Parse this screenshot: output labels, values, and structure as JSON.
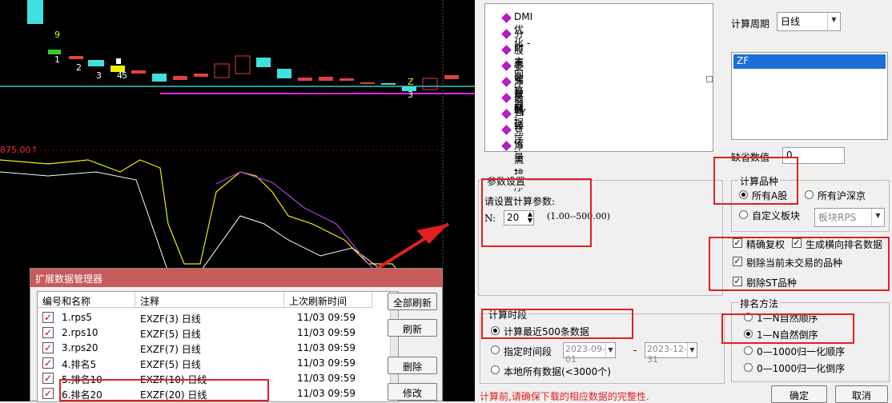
{
  "chart": {
    "numbers": [
      "9",
      "1",
      "2",
      "3",
      "4",
      "5",
      "Z",
      "3"
    ],
    "top_label": "875.00↑"
  },
  "manager": {
    "title": "扩展数据管理器",
    "headers": [
      "编号和名称",
      "注释",
      "上次刷新时间"
    ],
    "rows": [
      {
        "name": "1.rps5",
        "note": "EXZF(3) 日线",
        "time": "11/03 09:59"
      },
      {
        "name": "2.rps10",
        "note": "EXZF(5) 日线",
        "time": "11/03 09:59"
      },
      {
        "name": "3.rps20",
        "note": "EXZF(7) 日线",
        "time": "11/03 09:59"
      },
      {
        "name": "4.排名5",
        "note": "EXZF(5) 日线",
        "time": "11/03 09:59"
      },
      {
        "name": "5.排名10",
        "note": "EXZF(10) 日线",
        "time": "11/03 09:59"
      },
      {
        "name": "6.排名20",
        "note": "EXZF(20) 日线",
        "time": "11/03 09:59"
      }
    ],
    "buttons": [
      "全部刷新",
      "刷新",
      "删除",
      "修改"
    ]
  },
  "right": {
    "tree_items": [
      "DMI优化 -",
      "分时主图 -",
      "股票计算器 -",
      "委买数据 -",
      "净买数据 -",
      "最强排序 -",
      "YY -",
      "竞价量 -",
      "净流排序 -"
    ],
    "period_label": "计算周期",
    "period_value": "日线",
    "list_item": "ZF",
    "default_label": "缺省数值",
    "default_value": "0",
    "param_group": "参数设置",
    "param_prompt": "请设置计算参数:",
    "param_n_label": "N:",
    "param_n_value": "20",
    "param_range": "(1.00--500.00)",
    "variety_group": "计算品种",
    "variety_all_a": "所有A股",
    "variety_all_hs": "所有沪深京",
    "variety_custom": "自定义板块",
    "variety_sector": "板块RPS",
    "opt_precise": "精确复权",
    "opt_generate": "生成横向排名数据",
    "opt_remove_untraded": "剔除当前未交易的品种",
    "opt_remove_st": "剔除ST品种",
    "time_group": "计算时段",
    "time_recent": "计算最近500条数据",
    "time_range": "指定时间段",
    "date_from": "2023-09-01",
    "date_sep": "-",
    "date_to": "2023-12-31",
    "time_local": "本地所有数据(<3000个)",
    "rank_group": "排名方法",
    "rank_1": "1—N自然顺序",
    "rank_2": "1—N自然倒序",
    "rank_3": "0—1000归一化顺序",
    "rank_4": "0—1000归一化倒序",
    "warning": "计算前,请确保下载的相应数据的完整性.",
    "ok": "确定",
    "cancel": "取消"
  }
}
